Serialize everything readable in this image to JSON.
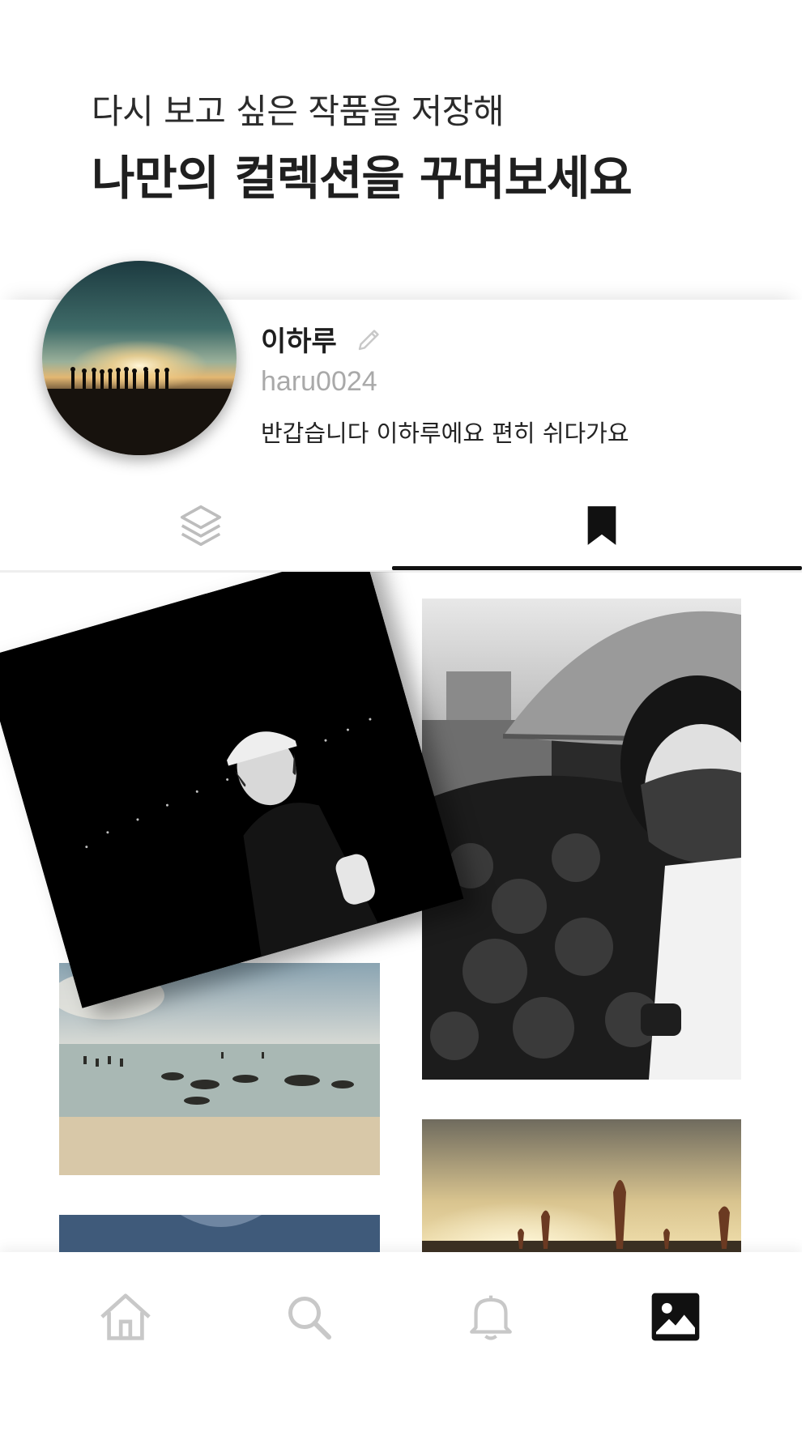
{
  "header": {
    "subtitle": "다시 보고 싶은 작품을 저장해",
    "title": "나만의 컬렉션을 꾸며보세요"
  },
  "profile": {
    "display_name": "이하루",
    "username": "haru0024",
    "bio": "반갑습니다 이하루에요 편히 쉬다가요"
  },
  "tabs": [
    {
      "icon": "layers-icon",
      "active": false
    },
    {
      "icon": "bookmark-icon",
      "active": true
    }
  ],
  "bottom_nav": [
    {
      "icon": "home-icon",
      "active": false
    },
    {
      "icon": "search-icon",
      "active": false
    },
    {
      "icon": "bell-icon",
      "active": false
    },
    {
      "icon": "gallery-icon",
      "active": true
    }
  ],
  "colors": {
    "active": "#111111",
    "inactive": "#bdbdbd",
    "muted_text": "#a9a9a9"
  }
}
